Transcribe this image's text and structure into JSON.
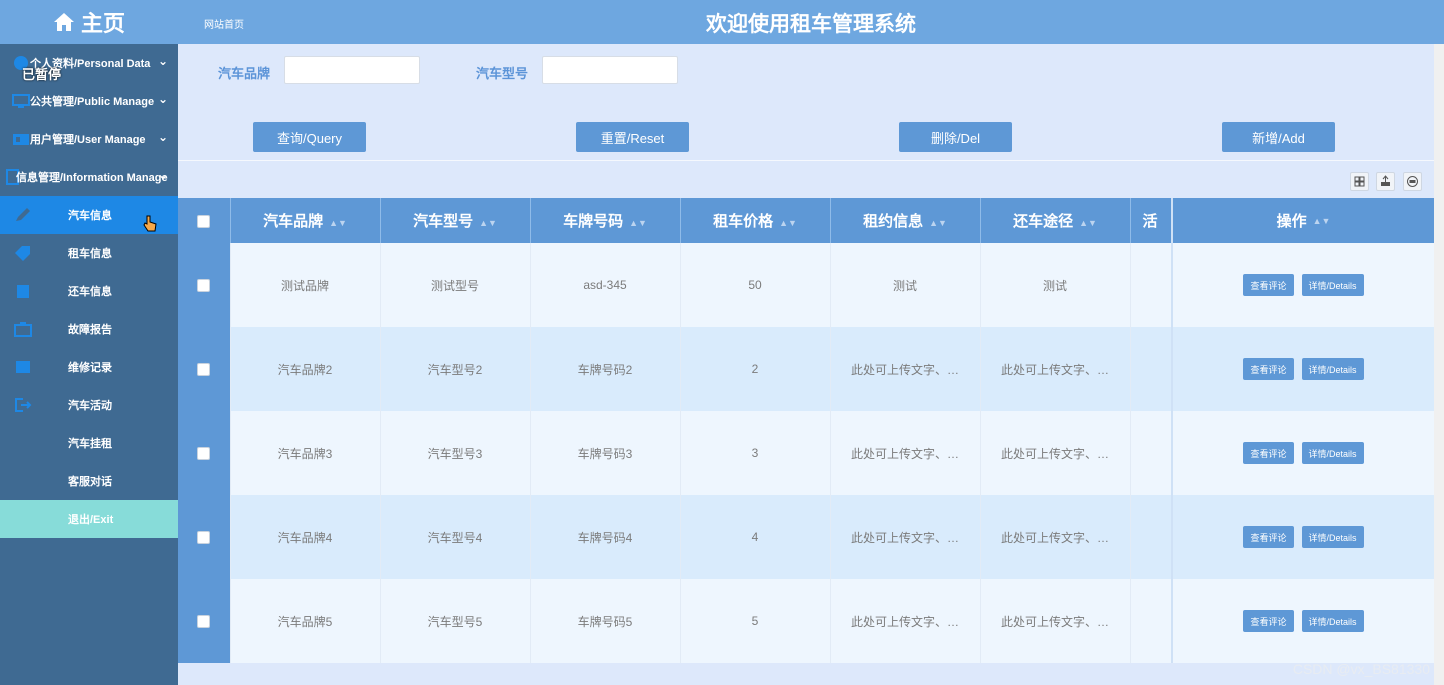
{
  "sidebar": {
    "brand": "主页",
    "paused_overlay": "已暂停",
    "groups": [
      {
        "label": "个人资料/Personal Data"
      },
      {
        "label": "公共管理/Public Manage"
      },
      {
        "label": "用户管理/User Manage"
      },
      {
        "label": "信息管理/Information Manage"
      }
    ],
    "items": [
      {
        "label": "汽车信息",
        "active": true
      },
      {
        "label": "租车信息"
      },
      {
        "label": "还车信息"
      },
      {
        "label": "故障报告"
      },
      {
        "label": "维修记录"
      },
      {
        "label": "汽车活动"
      },
      {
        "label": "汽车挂租"
      },
      {
        "label": "客服对话"
      },
      {
        "label": "退出/Exit"
      }
    ]
  },
  "header": {
    "breadcrumb": "网站首页",
    "title": "欢迎使用租车管理系统"
  },
  "search": {
    "brand_label": "汽车品牌",
    "brand_value": "",
    "model_label": "汽车型号",
    "model_value": ""
  },
  "buttons": {
    "query": "查询/Query",
    "reset": "重置/Reset",
    "delete": "删除/Del",
    "add": "新增/Add"
  },
  "table": {
    "headers": [
      "汽车品牌",
      "汽车型号",
      "车牌号码",
      "租车价格",
      "租约信息",
      "还车途径",
      "活"
    ],
    "action_header": "操作",
    "rows": [
      {
        "brand": "测试品牌",
        "model": "测试型号",
        "plate": "asd-345",
        "price": "50",
        "lease": "测试",
        "return": "测试"
      },
      {
        "brand": "汽车品牌2",
        "model": "汽车型号2",
        "plate": "车牌号码2",
        "price": "2",
        "lease": "此处可上传文字、…",
        "return": "此处可上传文字、…"
      },
      {
        "brand": "汽车品牌3",
        "model": "汽车型号3",
        "plate": "车牌号码3",
        "price": "3",
        "lease": "此处可上传文字、…",
        "return": "此处可上传文字、…"
      },
      {
        "brand": "汽车品牌4",
        "model": "汽车型号4",
        "plate": "车牌号码4",
        "price": "4",
        "lease": "此处可上传文字、…",
        "return": "此处可上传文字、…"
      },
      {
        "brand": "汽车品牌5",
        "model": "汽车型号5",
        "plate": "车牌号码5",
        "price": "5",
        "lease": "此处可上传文字、…",
        "return": "此处可上传文字、…"
      }
    ],
    "row_actions": {
      "comments": "查看评论",
      "details": "详情/Details"
    }
  },
  "watermark": "CSDN @vx_BS81330",
  "colors": {
    "sidebar_bg": "#3f6a92",
    "header_bg": "#6ea7e0",
    "accent": "#5e98d6",
    "active_item": "#1e88e5",
    "exit_item": "#87dcd9"
  }
}
